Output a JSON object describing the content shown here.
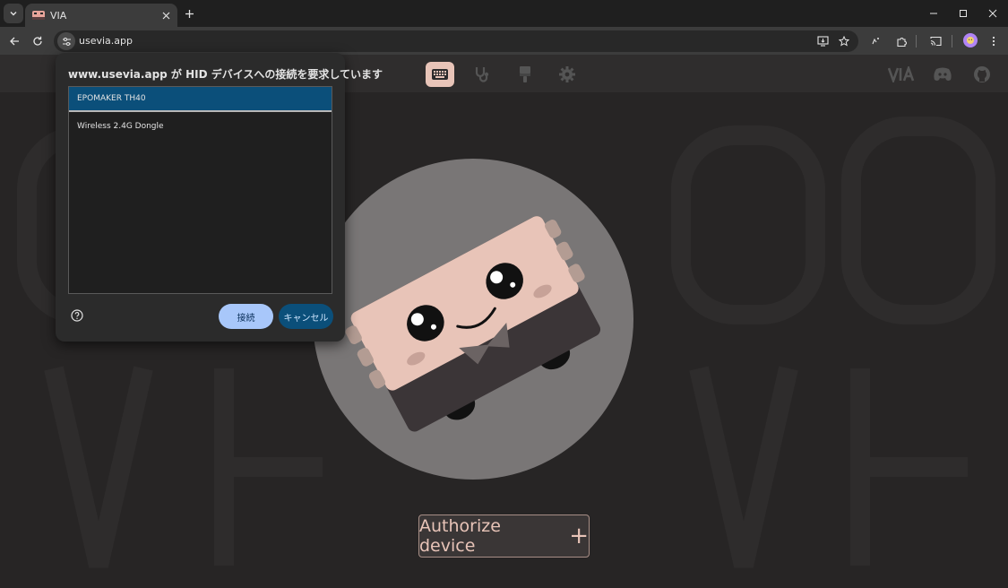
{
  "browser": {
    "tab": {
      "title": "VIA"
    },
    "address_bar": {
      "url": "usevia.app"
    },
    "icons": {
      "tab_search": "chevron-down-icon",
      "tab_close": "close-icon",
      "new_tab": "plus-icon",
      "back": "arrow-left-icon",
      "reload": "reload-icon",
      "site_info": "tune-icon",
      "install": "install-app-icon",
      "bookmark": "star-icon",
      "media": "media-icon",
      "extensions": "puzzle-icon",
      "cast": "cast-icon",
      "menu": "kebab-menu-icon"
    }
  },
  "hid_dialog": {
    "title": "www.usevia.app が HID デバイスへの接続を要求しています",
    "devices": [
      {
        "label": "EPOMAKER TH40",
        "selected": true
      },
      {
        "label": "Wireless 2.4G Dongle",
        "selected": false
      }
    ],
    "connect_label": "接続",
    "cancel_label": "キャンセル"
  },
  "app": {
    "nav_icons": [
      "keyboard-icon",
      "stethoscope-icon",
      "design-brush-icon",
      "settings-gear-icon"
    ],
    "right_icons": [
      "via-logo-icon",
      "discord-icon",
      "github-icon"
    ],
    "authorize_label": "Authorize device"
  },
  "colors": {
    "accent": "#e8c4b8",
    "dialog_selected": "#0b4f7a",
    "connect_button": "#a8c7fa",
    "app_background": "#272525"
  }
}
